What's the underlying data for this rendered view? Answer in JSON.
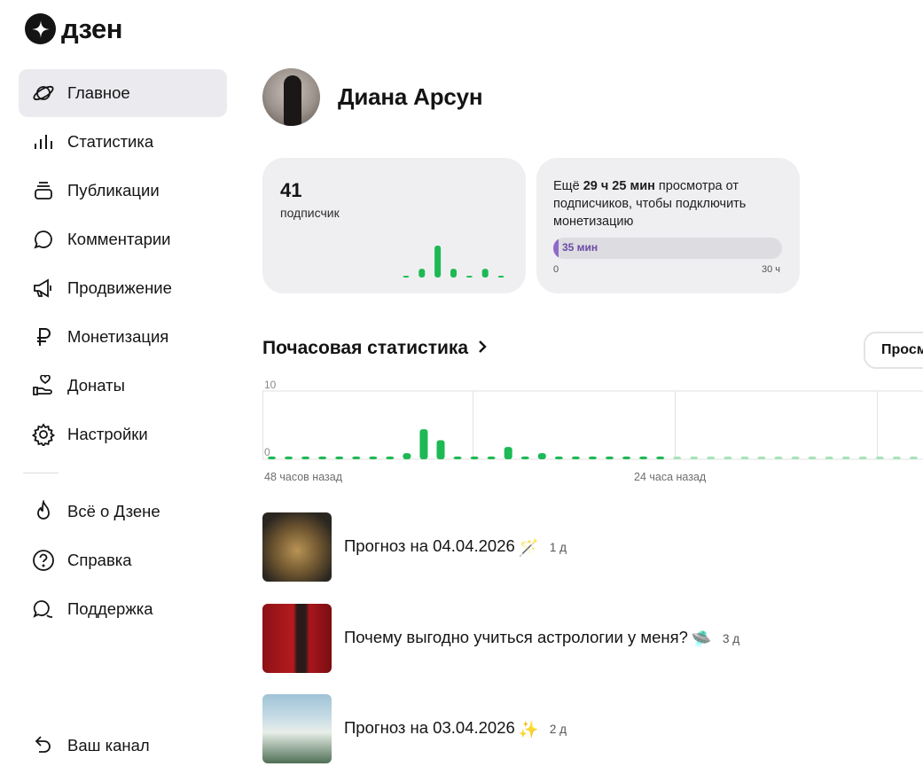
{
  "logo": {
    "text": "дзен"
  },
  "sidebar": {
    "items": [
      {
        "label": "Главное",
        "icon": "planet-icon",
        "active": true
      },
      {
        "label": "Статистика",
        "icon": "bar-chart-icon"
      },
      {
        "label": "Публикации",
        "icon": "publications-icon"
      },
      {
        "label": "Комментарии",
        "icon": "comment-icon"
      },
      {
        "label": "Продвижение",
        "icon": "megaphone-icon"
      },
      {
        "label": "Монетизация",
        "icon": "ruble-icon"
      },
      {
        "label": "Донаты",
        "icon": "donate-hand-icon"
      },
      {
        "label": "Настройки",
        "icon": "gear-icon"
      }
    ],
    "secondary": [
      {
        "label": "Всё о Дзене",
        "icon": "flame-icon"
      },
      {
        "label": "Справка",
        "icon": "help-icon"
      },
      {
        "label": "Поддержка",
        "icon": "support-chat-icon"
      }
    ],
    "footer": {
      "label": "Ваш канал",
      "icon": "back-arrow-icon"
    }
  },
  "profile": {
    "name": "Диана Арсун"
  },
  "subscribers": {
    "count": "41",
    "label": "подписчик"
  },
  "monetization": {
    "prefix": "Ещё ",
    "highlight": "29 ч 25 мин",
    "suffix": " просмотра от подписчиков, чтобы подключить монетизацию",
    "progress_label": "35 мин",
    "progress_fraction": 0.019,
    "min_label": "0",
    "max_label": "30 ч"
  },
  "hourly": {
    "title": "Почасовая статистика",
    "views_button": "Просмотры"
  },
  "chart_data": {
    "type": "bar",
    "ylim": [
      0,
      10
    ],
    "y_ticks": [
      "10",
      "0"
    ],
    "x_labels": [
      "48 часов назад",
      "24 часа назад"
    ],
    "color_recent": "#1db954",
    "color_older": "#a6e3b8",
    "values": [
      0.4,
      0.4,
      0.4,
      0.4,
      0.4,
      0.4,
      0.4,
      0.4,
      0.9,
      4.4,
      2.8,
      0.4,
      0.4,
      0.4,
      1.8,
      0.4,
      0.9,
      0.4,
      0.4,
      0.4,
      0.4,
      0.4,
      0.4,
      0.4,
      0.4,
      0.4,
      0.4,
      0.4,
      0.4,
      0.4,
      0.4,
      0.4,
      0.4,
      0.4,
      0.4,
      0.4,
      0.4,
      0.4,
      0.4,
      0.4,
      0.4,
      0.4
    ],
    "highlight_count": 24
  },
  "mini_chart": {
    "values": [
      0.1,
      0.6,
      2.2,
      0.6,
      0.1,
      0.6,
      0.1
    ],
    "color": "#1db954"
  },
  "publications": [
    {
      "title": "Прогноз на 04.04.2026",
      "emoji": "🪄",
      "age": "1 д"
    },
    {
      "title": "Почему выгодно учиться астрологии у меня?",
      "emoji": "🛸",
      "age": "3 д"
    },
    {
      "title": "Прогноз на 03.04.2026",
      "emoji": "✨",
      "age": "2 д"
    }
  ]
}
